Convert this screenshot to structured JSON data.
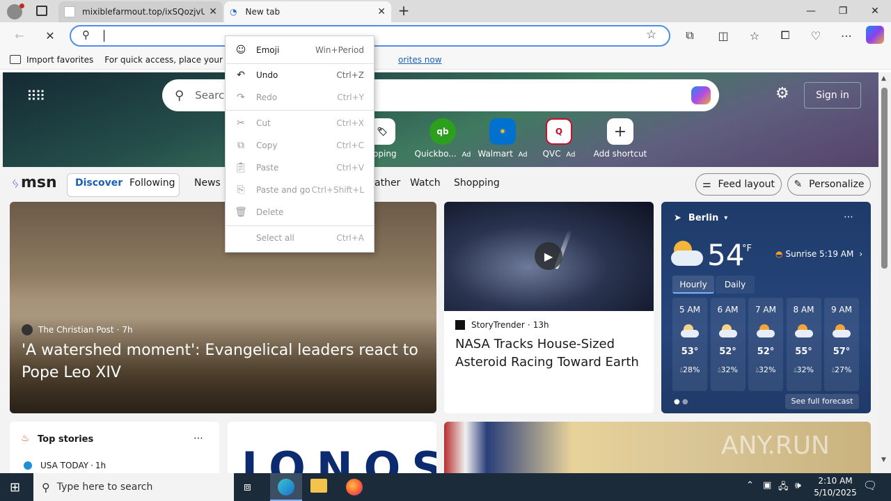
{
  "browser": {
    "tabs": [
      {
        "label": "mixiblefarmout.top/ixSQozjvUFV",
        "active": false
      },
      {
        "label": "New tab",
        "active": true
      }
    ],
    "new_tab_label": "+",
    "favorites_bar": {
      "import_label": "Import favorites",
      "prompt_text": "For quick access, place your favori",
      "link_text": "orites now"
    }
  },
  "context_menu": {
    "items": [
      {
        "label": "Emoji",
        "shortcut": "Win+Period",
        "enabled": true
      },
      {
        "label": "Undo",
        "shortcut": "Ctrl+Z",
        "enabled": true
      },
      {
        "label": "Redo",
        "shortcut": "Ctrl+Y",
        "enabled": false
      },
      {
        "label": "Cut",
        "shortcut": "Ctrl+X",
        "enabled": false
      },
      {
        "label": "Copy",
        "shortcut": "Ctrl+C",
        "enabled": false
      },
      {
        "label": "Paste",
        "shortcut": "Ctrl+V",
        "enabled": false
      },
      {
        "label": "Paste and go",
        "shortcut": "Ctrl+Shift+L",
        "enabled": false
      },
      {
        "label": "Delete",
        "shortcut": "",
        "enabled": false
      },
      {
        "label": "Select all",
        "shortcut": "Ctrl+A",
        "enabled": false
      }
    ]
  },
  "newtab": {
    "search_placeholder": "Searc",
    "sign_in": "Sign in",
    "shortcuts": [
      {
        "label": "opping",
        "ad": ""
      },
      {
        "label": "Quickbo...",
        "ad": "Ad"
      },
      {
        "label": "Walmart",
        "ad": "Ad"
      },
      {
        "label": "QVC",
        "ad": "Ad"
      },
      {
        "label": "Add shortcut",
        "ad": ""
      }
    ],
    "msn_logo": "msn",
    "nav": {
      "discover": "Discover",
      "following": "Following",
      "news": "News",
      "weather": "ather",
      "watch": "Watch",
      "shopping": "Shopping"
    },
    "feed_layout": "Feed layout",
    "personalize": "Personalize"
  },
  "cards": {
    "hero_story": {
      "source": "The Christian Post",
      "age": "7h",
      "headline": "'A watershed moment': Evangelical leaders react to Pope Leo XIV"
    },
    "space_story": {
      "source": "StoryTrender",
      "age": "13h",
      "headline": "NASA Tracks House-Sized Asteroid Racing Toward Earth"
    },
    "top_stories": {
      "title": "Top stories",
      "source": "USA TODAY",
      "age": "1h"
    },
    "ad_brand": "IONOS"
  },
  "weather": {
    "city": "Berlin",
    "temp": "54",
    "unit": "°F",
    "sunrise": "Sunrise 5:19 AM",
    "tabs": [
      "Hourly",
      "Daily"
    ],
    "hours": [
      {
        "time": "5 AM",
        "temp": "53°",
        "precip": "28%"
      },
      {
        "time": "6 AM",
        "temp": "52°",
        "precip": "32%"
      },
      {
        "time": "7 AM",
        "temp": "52°",
        "precip": "32%"
      },
      {
        "time": "8 AM",
        "temp": "55°",
        "precip": "32%"
      },
      {
        "time": "9 AM",
        "temp": "57°",
        "precip": "27%"
      }
    ],
    "full_forecast": "See full forecast"
  },
  "taskbar": {
    "search_placeholder": "Type here to search",
    "time": "2:10 AM",
    "date": "5/10/2025"
  },
  "watermark": "ANY.RUN"
}
